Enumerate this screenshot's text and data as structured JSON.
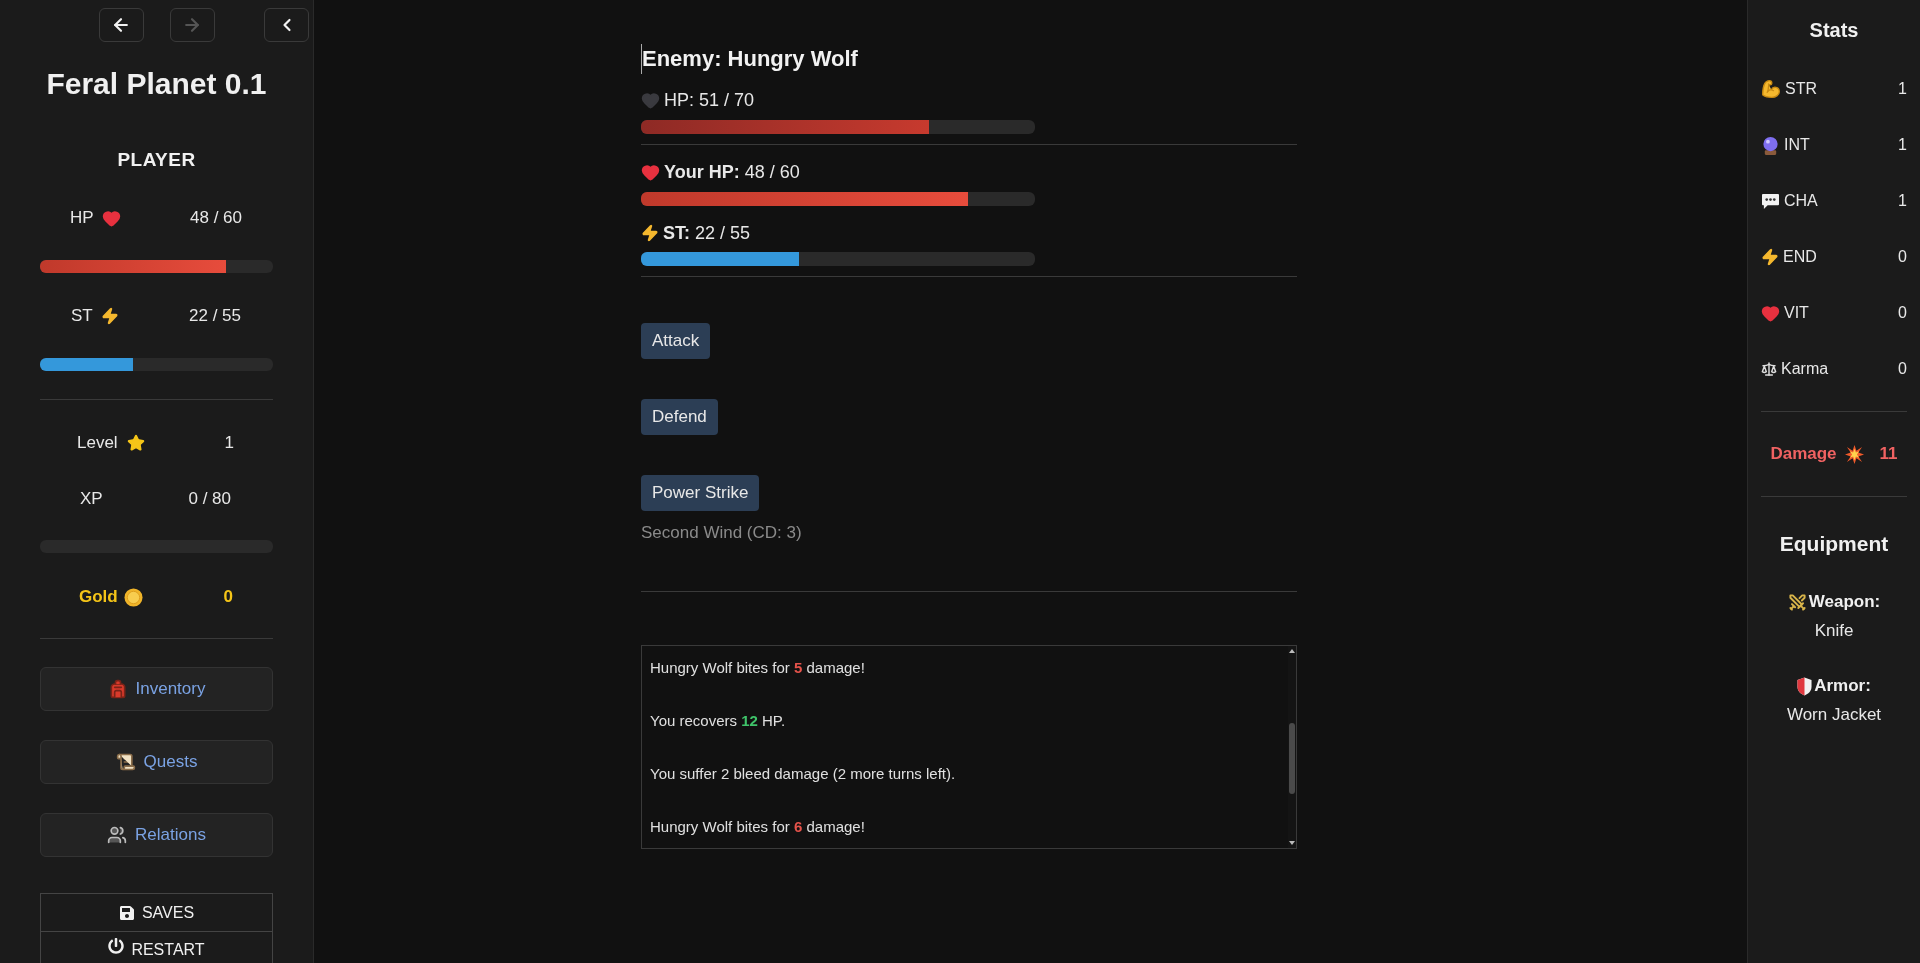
{
  "nav": {
    "buttons": [
      {
        "kind": "back",
        "disabled": false
      },
      {
        "kind": "forward",
        "disabled": true
      },
      {
        "kind": "collapse",
        "disabled": false
      }
    ]
  },
  "sidebar": {
    "title": "Feral Planet 0.1",
    "heading": "PLAYER",
    "hp": {
      "label": "HP",
      "value": "48 / 60",
      "level": 0.8
    },
    "st": {
      "label": "ST",
      "value": "22 / 55",
      "level": 0.4
    },
    "level": {
      "label": "Level",
      "value": "1"
    },
    "xp": {
      "label": "XP",
      "value": "0 / 80",
      "level": 0
    },
    "gold": {
      "label": "Gold",
      "value": "0"
    },
    "menu": [
      {
        "label": "Inventory"
      },
      {
        "label": "Quests"
      },
      {
        "label": "Relations"
      }
    ],
    "system_buttons": [
      {
        "label": "SAVES"
      },
      {
        "label": "RESTART"
      }
    ]
  },
  "combat": {
    "enemy_title": "Enemy: Hungry Wolf",
    "enemy_hp": {
      "label": "HP: 51 / 70",
      "level": 0.73
    },
    "player_hp": {
      "label": "**Your HP:** 48 / 60",
      "level": 0.83
    },
    "player_st": {
      "label": "**ST:** 22 / 55",
      "level": 0.4
    },
    "actions": [
      {
        "label": "Attack",
        "disabled": false
      },
      {
        "label": "Defend",
        "disabled": false
      },
      {
        "label": "Power Strike",
        "disabled": false
      },
      {
        "label": "Second Wind (CD: 3)",
        "disabled": true
      }
    ],
    "log": [
      {
        "kind": "damage",
        "text": "Hungry Wolf bites for **5** damage!"
      },
      {
        "kind": "heal",
        "text": "You recovers **12** HP."
      },
      {
        "kind": "plain",
        "text": "You suffer 2 bleed damage (2 more turns left)."
      },
      {
        "kind": "damage",
        "text": "Hungry Wolf bites for **6** damage!"
      }
    ]
  },
  "stats_panel": {
    "title": "Stats",
    "stats": [
      {
        "label": "STR",
        "value": "1"
      },
      {
        "label": "INT",
        "value": "1"
      },
      {
        "label": "CHA",
        "value": "1"
      },
      {
        "label": "END",
        "value": "0"
      },
      {
        "label": "VIT",
        "value": "0"
      },
      {
        "label": "Karma",
        "value": "0"
      }
    ],
    "damage": {
      "label": "Damage",
      "value": "11"
    },
    "equipment_title": "Equipment",
    "equipment": [
      {
        "label": "Weapon:",
        "value": "Knife"
      },
      {
        "label": "Armor:",
        "value": "Worn Jacket"
      }
    ]
  }
}
